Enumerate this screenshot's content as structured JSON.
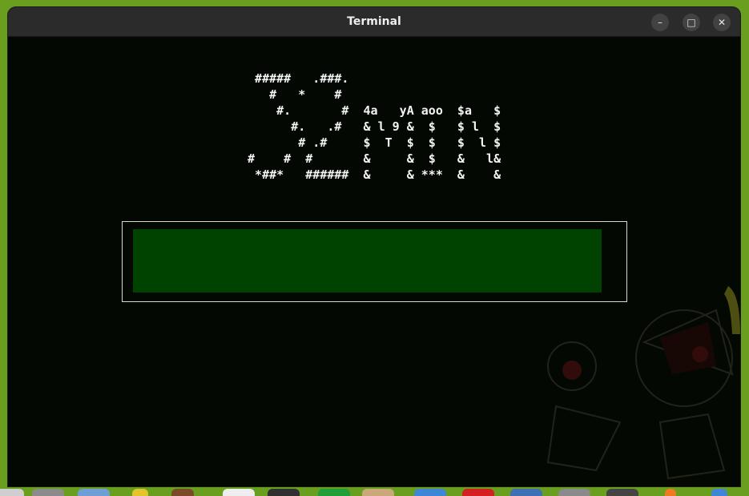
{
  "window": {
    "title": "Terminal",
    "controls": {
      "minimize": "–",
      "maximize": "□",
      "close": "✕"
    }
  },
  "terminal": {
    "ascii_art": [
      "  #####   .###.",
      "    #   *    #",
      "     #.       #  4a   yA aoo  $a   $",
      "       #.   .#   & l 9 &  $   $ l  $",
      "        # .#     $  T  $  $   $  l $",
      " #    #  #       &     &  $   &   l&",
      "  *##*   ######  &     & ***  &    &"
    ],
    "progress": {
      "fraction": 1.0
    }
  },
  "colors": {
    "desktop_background": "#6a9e1f",
    "terminal_background": "#030803",
    "progress_fill": "#004300",
    "progress_border": "#d8d8d8",
    "text": "#f4f4f4"
  },
  "dock": {
    "icons": [
      "files-icon",
      "folder-icon",
      "warning-icon",
      "books-icon",
      "text-editor-icon",
      "terminal-icon",
      "spreadsheet-icon",
      "archive-icon",
      "browser-icon",
      "media-icon",
      "software-icon",
      "settings-icon",
      "app-icon",
      "app-icon",
      "app-icon"
    ]
  }
}
